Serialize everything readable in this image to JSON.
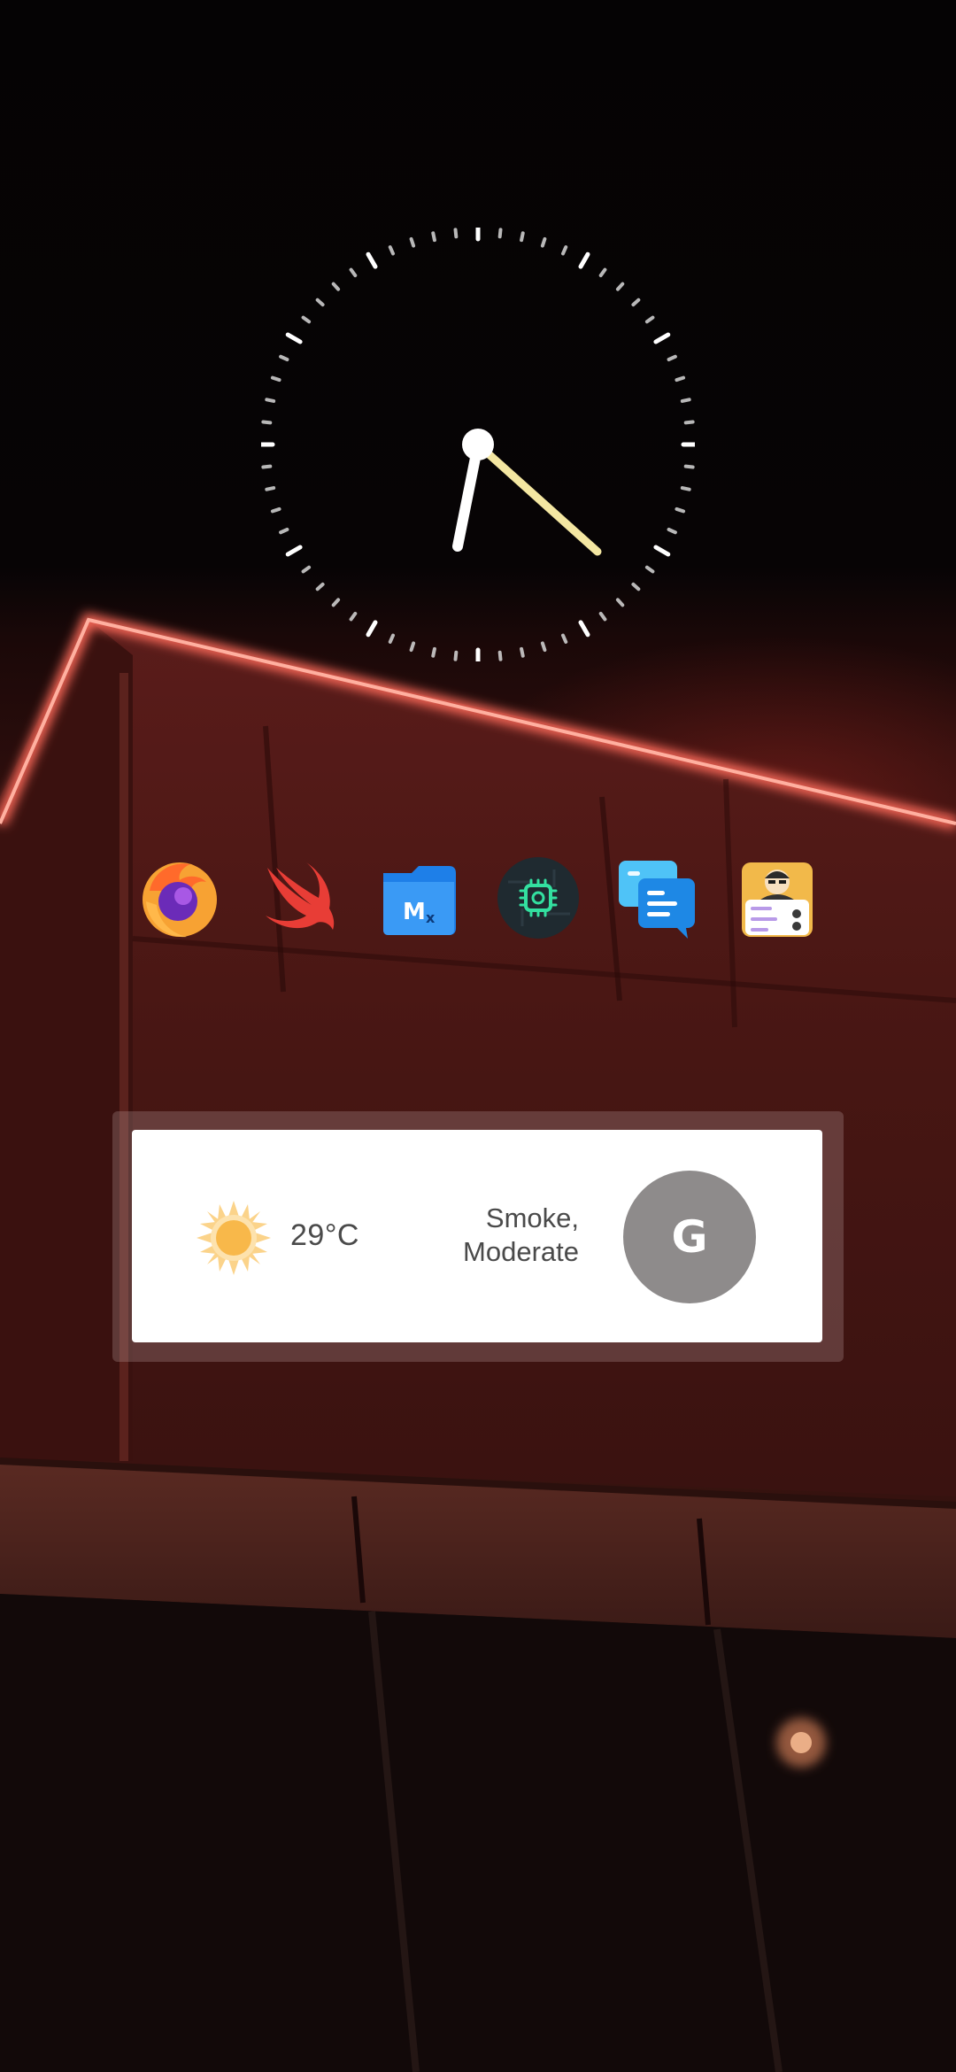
{
  "clock": {
    "type": "analog",
    "hands": {
      "hour": "white",
      "minute": "pale-yellow"
    },
    "colors": {
      "hour_hand": "#ffffff",
      "minute_hand": "#f4e7a2",
      "ticks": "#d8d8d8"
    }
  },
  "apps": [
    {
      "name": "firefox-nightly",
      "icon": "firefox-nightly-icon"
    },
    {
      "name": "swift",
      "icon": "swift-icon"
    },
    {
      "name": "mix-file-manager",
      "icon": "folder-icon"
    },
    {
      "name": "device-info",
      "icon": "chip-icon"
    },
    {
      "name": "messages",
      "icon": "chat-bubbles-icon"
    },
    {
      "name": "profile-checklist",
      "icon": "profile-checklist-icon"
    }
  ],
  "weather_widget": {
    "temperature": "29°C",
    "condition_line1": "Smoke,",
    "condition_line2": "Moderate",
    "weather_icon": "sun-icon",
    "search_label": "G",
    "colors": {
      "card": "#ffffff",
      "text": "#4a4a4a",
      "search_button": "#8e8b8b",
      "sun": "#f8b84a"
    }
  }
}
